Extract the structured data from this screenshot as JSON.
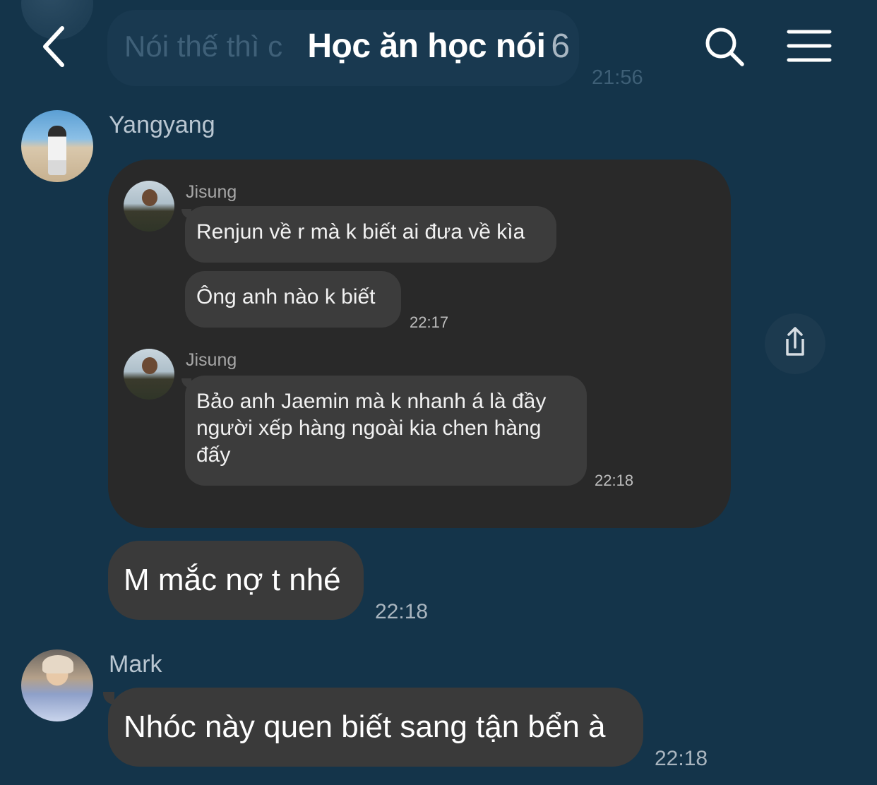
{
  "header": {
    "title": "Học ăn học nói",
    "member_count": "6"
  },
  "previous_message": {
    "text": "Nói thế thì c",
    "time": "21:56"
  },
  "messages": [
    {
      "sender": "Yangyang",
      "shared_card": {
        "items": [
          {
            "sender": "Jisung",
            "bubbles": [
              "Renjun về r mà k biết ai đưa về kìa",
              "Ông anh nào k biết"
            ],
            "time": "22:17"
          },
          {
            "sender": "Jisung",
            "bubbles": [
              "Bảo anh Jaemin mà k nhanh á là đầy người xếp hàng ngoài kia chen hàng đấy"
            ],
            "time": "22:18"
          }
        ]
      },
      "text": "M mắc nợ t nhé",
      "time": "22:18"
    },
    {
      "sender": "Mark",
      "text": "Nhóc này quen biết sang tận bển à",
      "time": "22:18"
    }
  ],
  "icons": {
    "back": "chevron-left-icon",
    "search": "search-icon",
    "menu": "hamburger-menu-icon",
    "share": "share-icon"
  },
  "colors": {
    "background": "#14344a",
    "bubble": "#3a3a3a",
    "card": "#292929",
    "inner_bubble": "#3c3c3c"
  }
}
